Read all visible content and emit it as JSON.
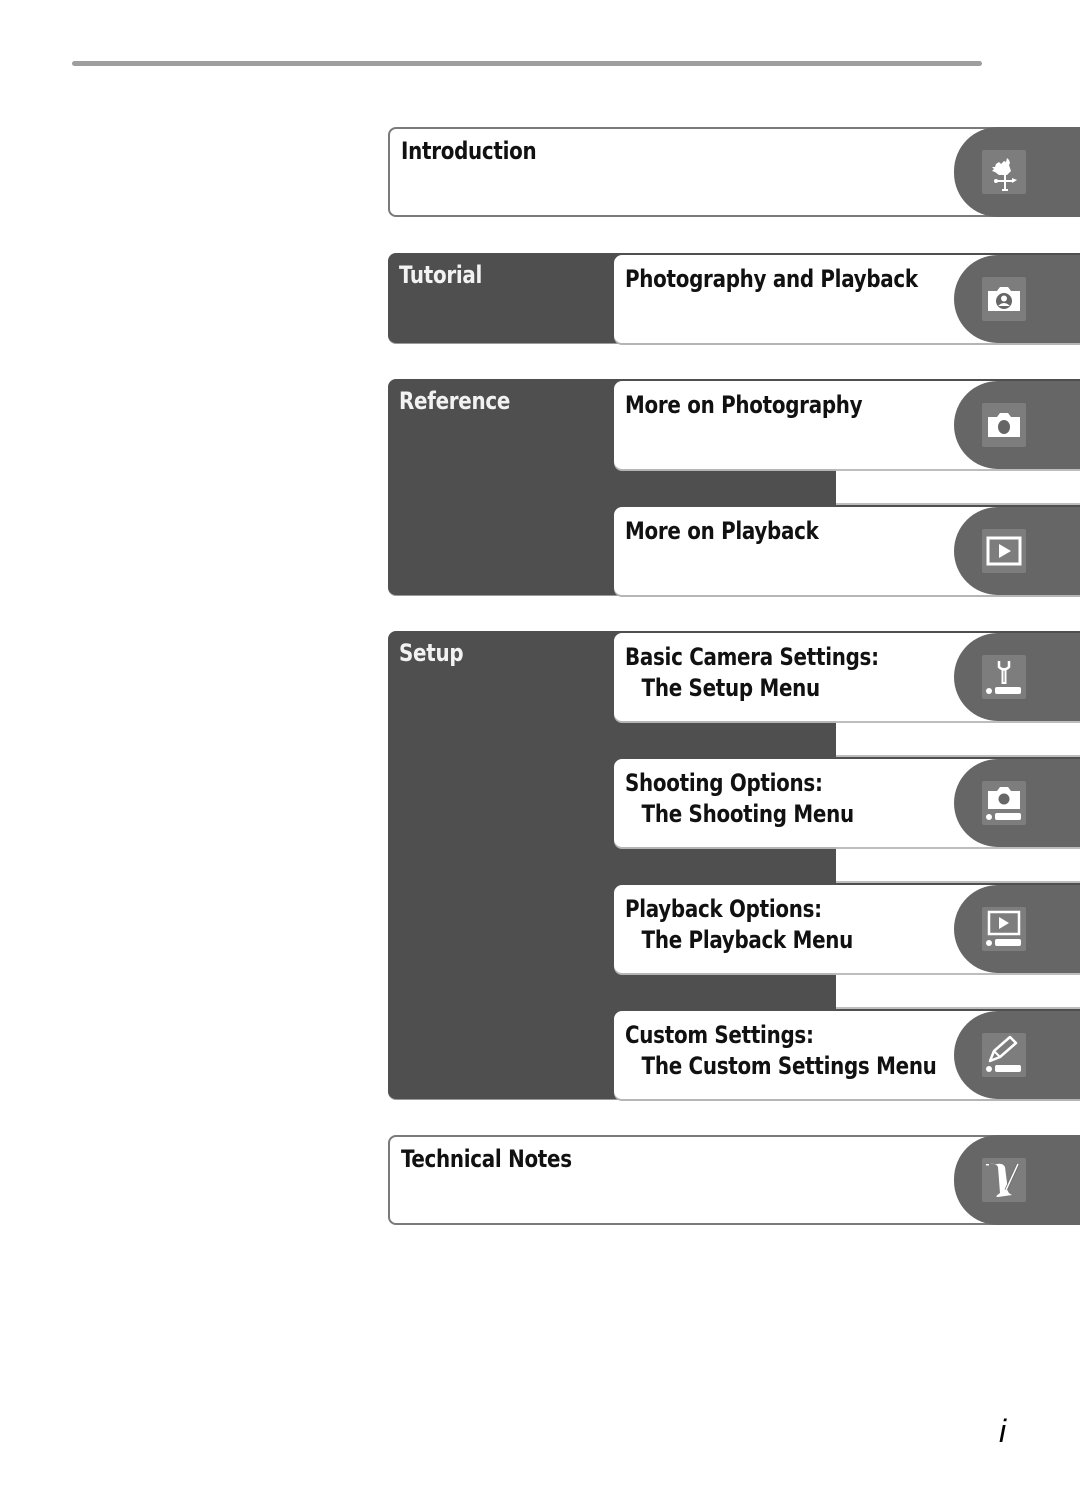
{
  "page": {
    "page_number": "i"
  },
  "sections": {
    "introduction": {
      "label": "Introduction",
      "icon": "weathervane-icon"
    },
    "tutorial": {
      "label": "Tutorial",
      "items": [
        {
          "title": "Photography and Playback",
          "subtitle": "",
          "icon": "camera-portrait-icon"
        }
      ]
    },
    "reference": {
      "label": "Reference",
      "items": [
        {
          "title": "More on Photography",
          "subtitle": "",
          "icon": "camera-icon"
        },
        {
          "title": "More on Playback",
          "subtitle": "",
          "icon": "playback-icon"
        }
      ]
    },
    "setup": {
      "label": "Setup",
      "items": [
        {
          "title": "Basic Camera Settings:",
          "subtitle": "The Setup Menu",
          "icon": "setup-menu-wrench-icon"
        },
        {
          "title": "Shooting Options:",
          "subtitle": "The Shooting Menu",
          "icon": "shooting-menu-camera-icon"
        },
        {
          "title": "Playback Options:",
          "subtitle": "The Playback Menu",
          "icon": "playback-menu-icon"
        },
        {
          "title": "Custom Settings:",
          "subtitle": "The Custom Settings Menu",
          "icon": "custom-settings-pencil-icon"
        }
      ]
    },
    "technical_notes": {
      "label": "Technical Notes",
      "icon": "scroll-quill-icon"
    }
  },
  "colors": {
    "section_dark": "#4f4f4f",
    "tab_grey": "#666666",
    "icon_bg": "#7d7d7d",
    "rule": "#9e9e9e"
  }
}
